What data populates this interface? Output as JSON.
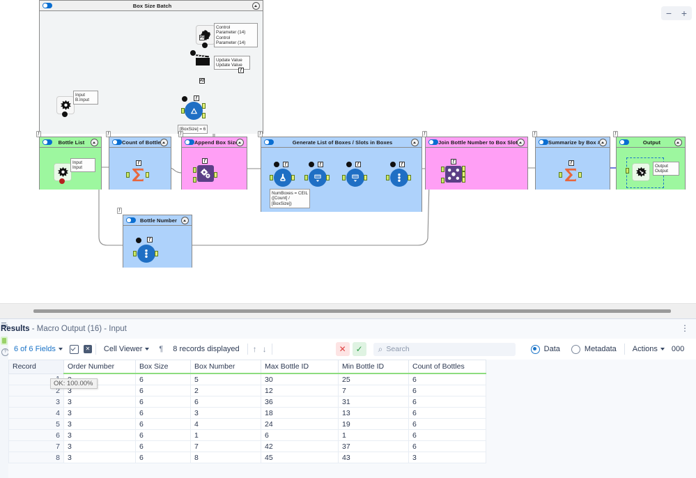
{
  "canvas": {
    "zoom_controls": {
      "zoom_out": "−",
      "zoom_in": "+"
    },
    "batch_container": {
      "title": "Box Size Batch",
      "tag": "",
      "annotations": {
        "control_parameter": "Control\nParameter (14)\nControl\nParameter (14)",
        "update_value": "Update Value\nUpdate Value",
        "input": "Input\nB.Input",
        "formula": "[BoxSize] = 6"
      },
      "labels": {
        "conn1": "#1",
        "conn2": "#2"
      }
    },
    "containers": [
      {
        "title": "Bottle List",
        "tag": "⌁",
        "color": "green",
        "annotations": {
          "input": "Input\nInput"
        }
      },
      {
        "title": "Count of Bottles",
        "tag": "⌁",
        "color": "blue",
        "annotations": {}
      },
      {
        "title": "Append Box Size",
        "tag": "⌁",
        "color": "pink",
        "annotations": {}
      },
      {
        "title": "Generate List of Boxes / Slots in Boxes",
        "tag": "⌁",
        "color": "blue",
        "annotations": {
          "formula": "NumBoxes = CEIL\n([Count] /\n[BoxSize])"
        }
      },
      {
        "title": "Join Bottle Number to Box Slot",
        "tag": "⌁",
        "color": "pink",
        "annotations": {}
      },
      {
        "title": "Summarize by Box #",
        "tag": "⌁",
        "color": "blue",
        "annotations": {}
      },
      {
        "title": "Output",
        "tag": "⌁",
        "color": "green",
        "annotations": {
          "output": "Output\nOutput"
        }
      },
      {
        "title": "Bottle Number",
        "tag": "⌁",
        "color": "blue",
        "annotations": {}
      }
    ]
  },
  "results": {
    "title_bold": "Results",
    "title_rest": " - Macro Output (16) - Input",
    "kebab": "⋮",
    "toolbar": {
      "fields": "6 of 6 Fields",
      "cell_viewer": "Cell Viewer",
      "pilcrow": "¶",
      "records": "8 records displayed",
      "arrow_up": "↑",
      "arrow_down": "↓",
      "btn_reject": "✕",
      "btn_accept": "✓",
      "search_placeholder": "Search",
      "search_value": "",
      "search_icon": "⌕",
      "radio_data": "Data",
      "radio_metadata": "Metadata",
      "radio_selected": "Data",
      "actions": "Actions",
      "trailing": "000"
    },
    "table": {
      "columns": [
        "Record",
        "Order Number",
        "Box Size",
        "Box Number",
        "Max Bottle ID",
        "Min Bottle ID",
        "Count of Bottles"
      ],
      "rows": [
        [
          "1",
          "3",
          "6",
          "5",
          "30",
          "25",
          "6"
        ],
        [
          "2",
          "3",
          "6",
          "2",
          "12",
          "7",
          "6"
        ],
        [
          "3",
          "3",
          "6",
          "6",
          "36",
          "31",
          "6"
        ],
        [
          "4",
          "3",
          "6",
          "3",
          "18",
          "13",
          "6"
        ],
        [
          "5",
          "3",
          "6",
          "4",
          "24",
          "19",
          "6"
        ],
        [
          "6",
          "3",
          "6",
          "1",
          "6",
          "1",
          "6"
        ],
        [
          "7",
          "3",
          "6",
          "7",
          "42",
          "37",
          "6"
        ],
        [
          "8",
          "3",
          "6",
          "8",
          "45",
          "43",
          "3"
        ]
      ],
      "cell_tooltip": "OK: 100.00%"
    }
  },
  "colors": {
    "green": "#9df79f",
    "blue": "#aed2fb",
    "pink": "#ff9ff5",
    "accent": "#1a73c7",
    "node_blue": "#1f6fc4",
    "node_purple": "#5b3f86",
    "sigma_orange": "#e8663c",
    "wire": "#8a8a8a",
    "wire_blue": "#1b2ec4"
  }
}
